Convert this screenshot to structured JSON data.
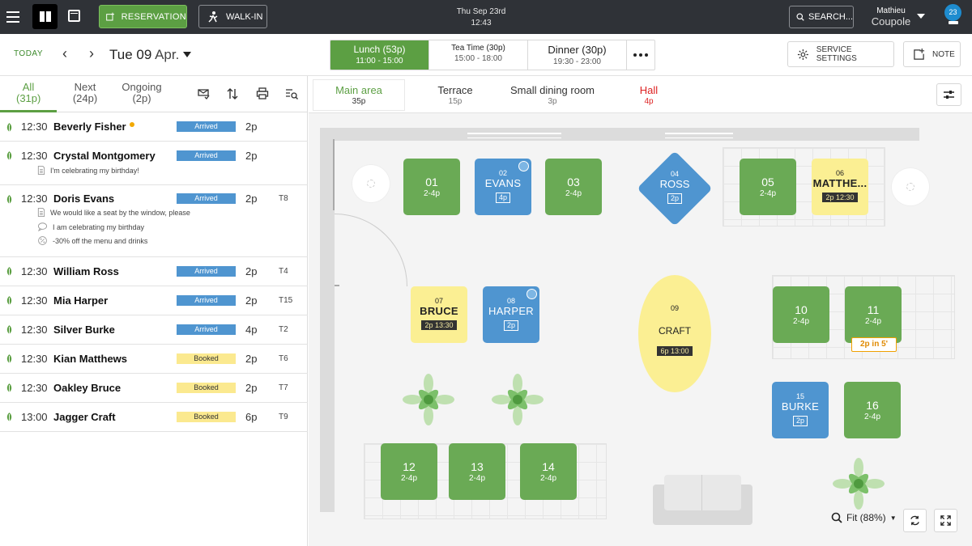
{
  "topbar": {
    "reservation_label": "RESERVATION",
    "walkin_label": "WALK-IN",
    "date_line": "Thu Sep 23rd",
    "time_line": "12:43",
    "search_label": "SEARCH...",
    "user_name": "Mathieu",
    "restaurant": "Coupole",
    "notification_count": "23"
  },
  "datebar": {
    "today_label": "TODAY",
    "date_day": "Tue 09",
    "date_month": "Apr.",
    "services": [
      {
        "name": "Lunch (53p)",
        "hours": "11:00 - 15:00"
      },
      {
        "name": "Tea Time (30p)",
        "hours": "15:00 - 18:00"
      },
      {
        "name": "Dinner (30p)",
        "hours": "19:30 - 23:00"
      }
    ],
    "service_settings_label": "SERVICE SETTINGS",
    "note_label": "NOTE"
  },
  "list_tabs": [
    {
      "label": "All",
      "count": "(31p)"
    },
    {
      "label": "Next",
      "count": "(24p)"
    },
    {
      "label": "Ongoing",
      "count": "(2p)"
    }
  ],
  "reservations": [
    {
      "time": "12:30",
      "name": "Beverly Fisher",
      "status": "Arrived",
      "pax": "2p",
      "table": ""
    },
    {
      "time": "12:30",
      "name": "Crystal Montgomery",
      "status": "Arrived",
      "pax": "2p",
      "table": "",
      "notes": [
        "I'm celebrating my birthday!"
      ]
    },
    {
      "time": "12:30",
      "name": "Doris Evans",
      "status": "Arrived",
      "pax": "2p",
      "table": "T8",
      "notes": [
        "We would like a seat by the window, please",
        "I am celebrating my birthday",
        "-30% off the menu and drinks"
      ]
    },
    {
      "time": "12:30",
      "name": "William Ross",
      "status": "Arrived",
      "pax": "2p",
      "table": "T4"
    },
    {
      "time": "12:30",
      "name": "Mia Harper",
      "status": "Arrived",
      "pax": "2p",
      "table": "T15"
    },
    {
      "time": "12:30",
      "name": "Silver Burke",
      "status": "Arrived",
      "pax": "4p",
      "table": "T2"
    },
    {
      "time": "12:30",
      "name": "Kian Matthews",
      "status": "Booked",
      "pax": "2p",
      "table": "T6"
    },
    {
      "time": "12:30",
      "name": "Oakley Bruce",
      "status": "Booked",
      "pax": "2p",
      "table": "T7"
    },
    {
      "time": "13:00",
      "name": "Jagger Craft",
      "status": "Booked",
      "pax": "6p",
      "table": "T9"
    }
  ],
  "rooms": [
    {
      "name": "Main area",
      "pax": "35p"
    },
    {
      "name": "Terrace",
      "pax": "15p"
    },
    {
      "name": "Small dining room",
      "pax": "3p"
    },
    {
      "name": "Hall",
      "pax": "4p"
    }
  ],
  "tables": {
    "t01": {
      "num": "01",
      "cap": "2-4p"
    },
    "t02": {
      "num": "02",
      "name": "EVANS",
      "pax": "4p"
    },
    "t03": {
      "num": "03",
      "cap": "2-4p"
    },
    "t04": {
      "num": "04",
      "name": "ROSS",
      "pax": "2p"
    },
    "t05": {
      "num": "05",
      "cap": "2-4p"
    },
    "t06": {
      "num": "06",
      "name": "MATTHE...",
      "tag": "2p 12:30"
    },
    "t07": {
      "num": "07",
      "name": "BRUCE",
      "tag": "2p 13:30"
    },
    "t08": {
      "num": "08",
      "name": "HARPER",
      "pax": "2p"
    },
    "t09": {
      "num": "09",
      "name": "CRAFT",
      "tag": "6p 13:00"
    },
    "t10": {
      "num": "10",
      "cap": "2-4p"
    },
    "t11": {
      "num": "11",
      "cap": "2-4p",
      "alert": "2p in 5'"
    },
    "t12": {
      "num": "12",
      "cap": "2-4p"
    },
    "t13": {
      "num": "13",
      "cap": "2-4p"
    },
    "t14": {
      "num": "14",
      "cap": "2-4p"
    },
    "t15": {
      "num": "15",
      "name": "BURKE",
      "pax": "2p"
    },
    "t16": {
      "num": "16",
      "cap": "2-4p"
    }
  },
  "zoom": {
    "label": "Fit (88%)"
  },
  "colors": {
    "brand_green": "#5c9f43",
    "table_green": "#6aaa55",
    "table_blue": "#4f95d0",
    "table_yellow": "#fbef93",
    "alert_orange": "#f0a000",
    "hall_red": "#dd2222"
  }
}
